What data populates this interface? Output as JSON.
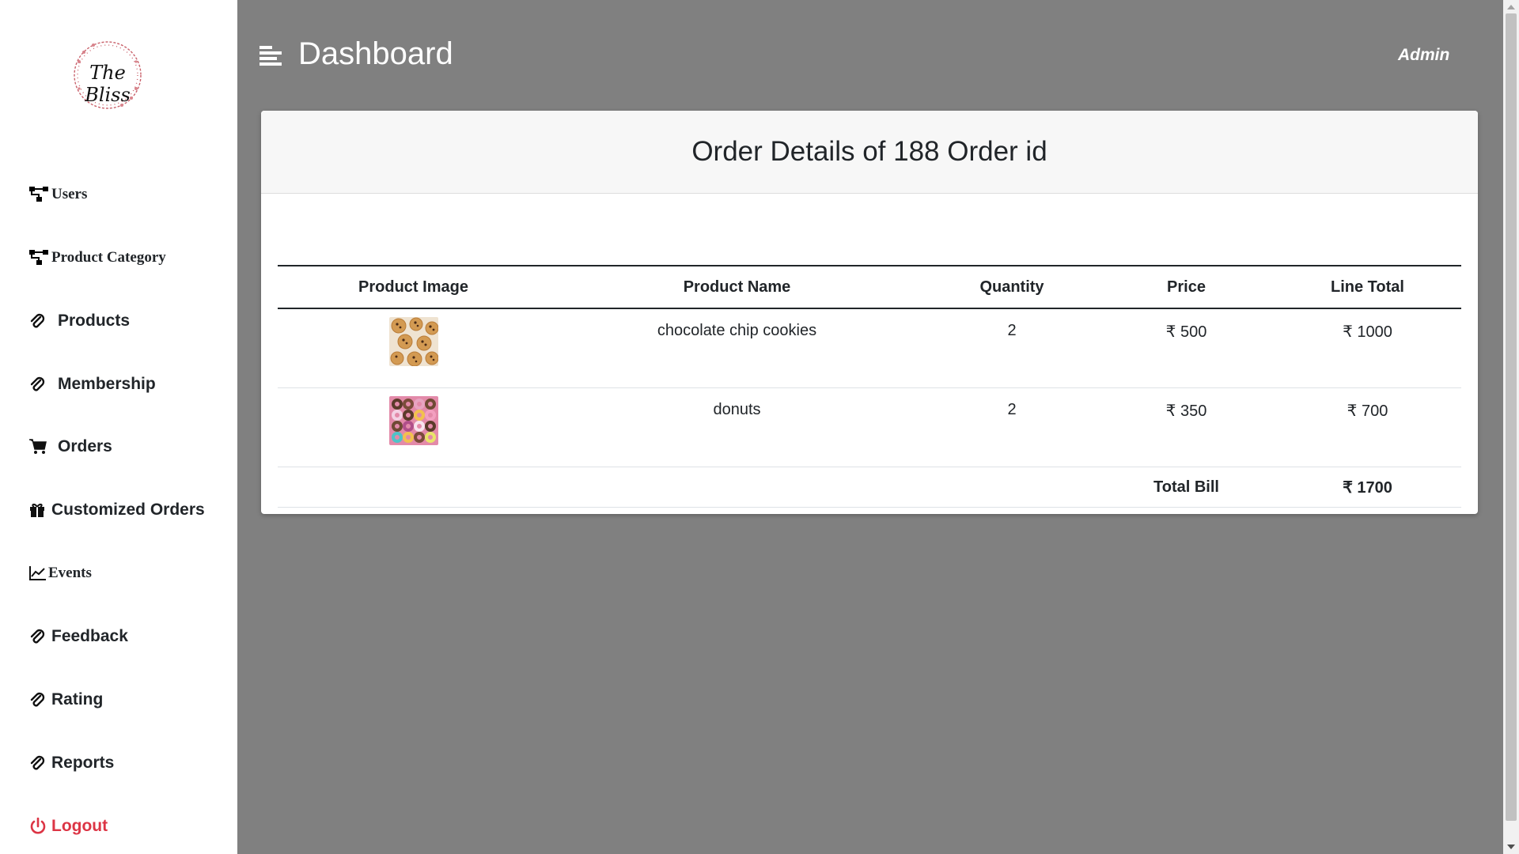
{
  "brand": {
    "logo_text": "The Bliss"
  },
  "header": {
    "title": "Dashboard",
    "user": "Admin"
  },
  "sidebar": {
    "items": [
      {
        "label": "Users",
        "icon": "sitemap-icon"
      },
      {
        "label": "Product Category",
        "icon": "sitemap-icon"
      },
      {
        "label": "Products",
        "icon": "paperclip-icon"
      },
      {
        "label": "Membership",
        "icon": "paperclip-icon"
      },
      {
        "label": "Orders",
        "icon": "cart-icon"
      },
      {
        "label": "Customized Orders",
        "icon": "gift-icon"
      },
      {
        "label": "Events",
        "icon": "line-chart-icon"
      },
      {
        "label": "Feedback",
        "icon": "paperclip-icon"
      },
      {
        "label": "Rating",
        "icon": "paperclip-icon"
      },
      {
        "label": "Reports",
        "icon": "paperclip-icon"
      },
      {
        "label": "Logout",
        "icon": "power-icon"
      }
    ]
  },
  "order": {
    "title": "Order Details of 188 Order id",
    "columns": [
      "Product Image",
      "Product Name",
      "Quantity",
      "Price",
      "Line Total"
    ],
    "rows": [
      {
        "image": "cookies-image",
        "name": "chocolate chip cookies",
        "quantity": "2",
        "price": "₹ 500",
        "line_total": "₹ 1000"
      },
      {
        "image": "donuts-image",
        "name": "donuts",
        "quantity": "2",
        "price": "₹ 350",
        "line_total": "₹ 700"
      }
    ],
    "total_label": "Total Bill",
    "total_value": "₹ 1700"
  },
  "colors": {
    "background": "#808080",
    "sidebar": "#ffffff",
    "logout": "#dc3545"
  }
}
